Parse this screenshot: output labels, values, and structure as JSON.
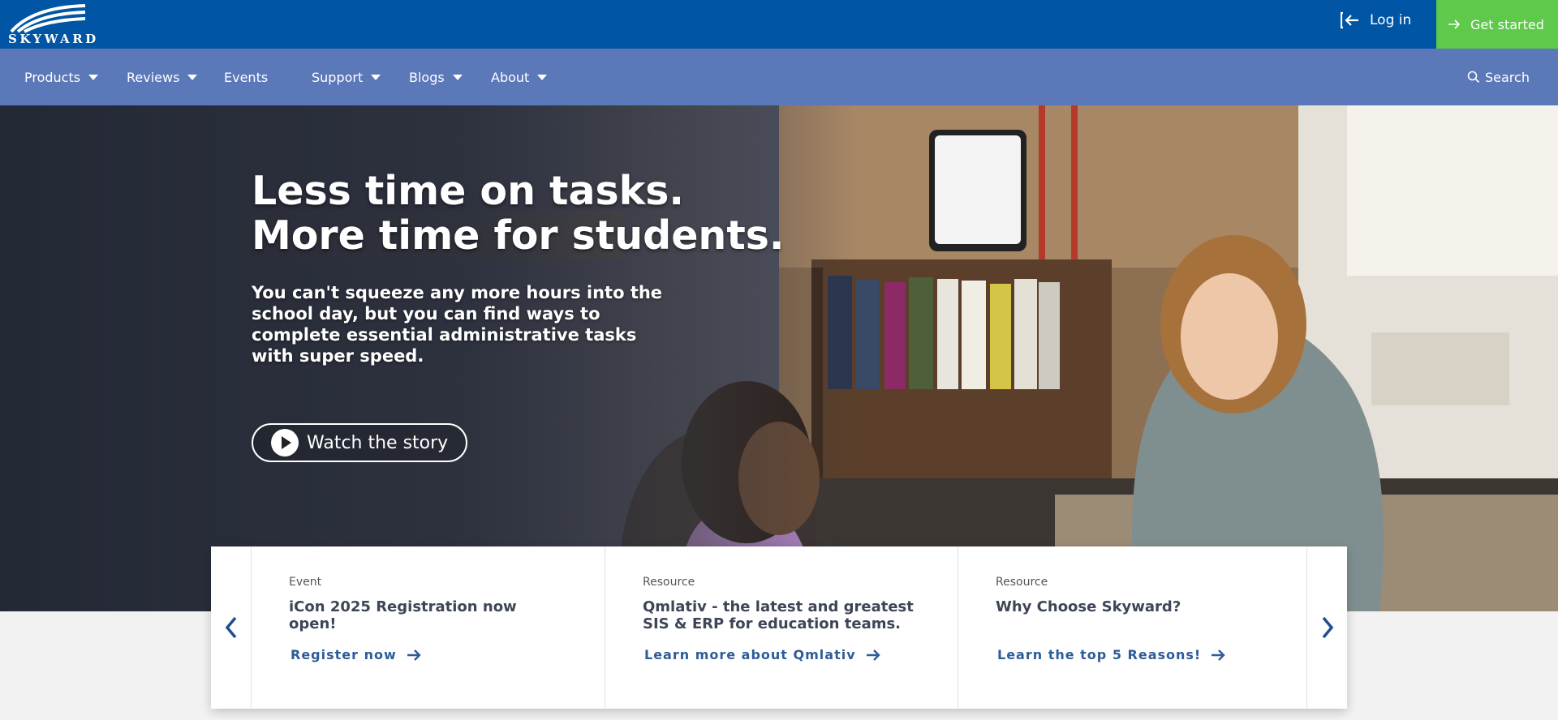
{
  "brand": {
    "logo_text": "SKYWARD"
  },
  "header": {
    "login_label": "Log in",
    "get_started_label": "Get started"
  },
  "nav": {
    "items": [
      {
        "label": "Products"
      },
      {
        "label": "Reviews"
      },
      {
        "label": "Events"
      },
      {
        "label": "Support"
      },
      {
        "label": "Blogs"
      },
      {
        "label": "About"
      }
    ],
    "search_label": "Search"
  },
  "hero": {
    "title_line1": "Less time on tasks.",
    "title_line2": "More time for students.",
    "subtitle": "You can't squeeze any more hours into the school day, but you can find ways to complete essential administrative tasks with super speed.",
    "cta_label": "Watch the story"
  },
  "cards": [
    {
      "type": "Event",
      "title": "iCon 2025 Registration now open!",
      "link": "Register now"
    },
    {
      "type": "Resource",
      "title": "Qmlativ - the latest and greatest SIS & ERP for education teams.",
      "link": "Learn more about Qmlativ"
    },
    {
      "type": "Resource",
      "title": "Why Choose Skyward?",
      "link": "Learn the top 5 Reasons!"
    }
  ],
  "colors": {
    "topbar": "#0055a5",
    "nav": "#5b78b9",
    "cta_green": "#5ec94a",
    "link_blue": "#2e5c99"
  }
}
